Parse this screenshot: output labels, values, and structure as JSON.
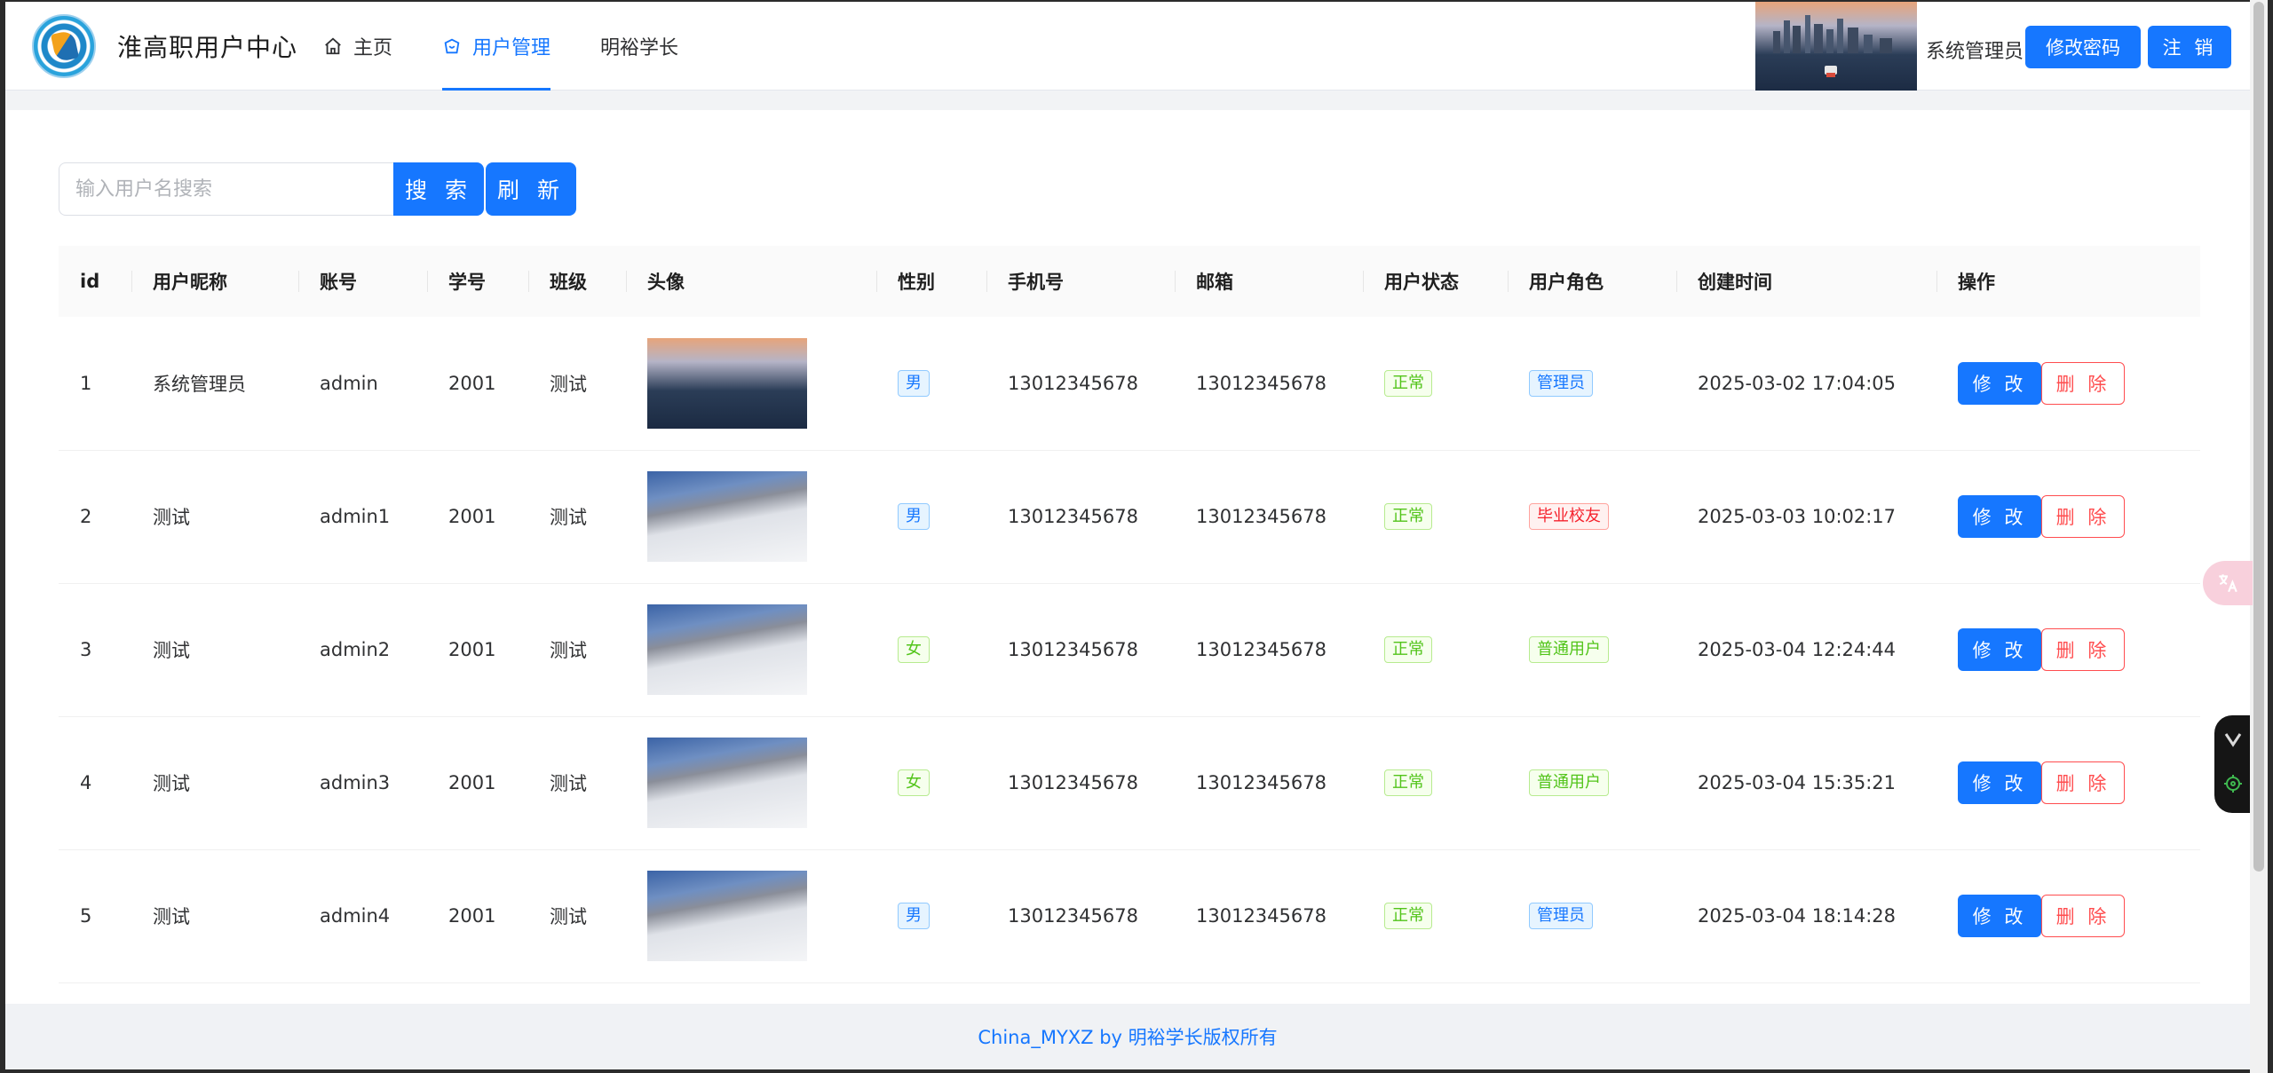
{
  "header": {
    "brand": "淮高职用户中心",
    "nav": [
      {
        "label": "主页",
        "icon": "home-icon"
      },
      {
        "label": "用户管理",
        "icon": "user-manage-icon",
        "active": true
      },
      {
        "label": "明裕学长",
        "icon": ""
      }
    ],
    "admin_name": "系统管理员",
    "change_password": "修改密码",
    "logout": "注 销"
  },
  "search": {
    "placeholder": "输入用户名搜索",
    "search_label": "搜 索",
    "refresh_label": "刷 新"
  },
  "table": {
    "columns": [
      "id",
      "用户昵称",
      "账号",
      "学号",
      "班级",
      "头像",
      "性别",
      "手机号",
      "邮箱",
      "用户状态",
      "用户角色",
      "创建时间",
      "操作"
    ],
    "edit_label": "修 改",
    "delete_label": "删 除",
    "rows": [
      {
        "id": "1",
        "nickname": "系统管理员",
        "account": "admin",
        "student_no": "2001",
        "class": "测试",
        "avatar": "city-skyline",
        "gender": "男",
        "phone": "13012345678",
        "email": "13012345678",
        "status": "正常",
        "role": "管理员",
        "created": "2025-03-02 17:04:05"
      },
      {
        "id": "2",
        "nickname": "测试",
        "account": "admin1",
        "student_no": "2001",
        "class": "测试",
        "avatar": "snow-mountain",
        "gender": "男",
        "phone": "13012345678",
        "email": "13012345678",
        "status": "正常",
        "role": "毕业校友",
        "created": "2025-03-03 10:02:17"
      },
      {
        "id": "3",
        "nickname": "测试",
        "account": "admin2",
        "student_no": "2001",
        "class": "测试",
        "avatar": "snow-mountain",
        "gender": "女",
        "phone": "13012345678",
        "email": "13012345678",
        "status": "正常",
        "role": "普通用户",
        "created": "2025-03-04 12:24:44"
      },
      {
        "id": "4",
        "nickname": "测试",
        "account": "admin3",
        "student_no": "2001",
        "class": "测试",
        "avatar": "snow-mountain",
        "gender": "女",
        "phone": "13012345678",
        "email": "13012345678",
        "status": "正常",
        "role": "普通用户",
        "created": "2025-03-04 15:35:21"
      },
      {
        "id": "5",
        "nickname": "测试",
        "account": "admin4",
        "student_no": "2001",
        "class": "测试",
        "avatar": "snow-mountain",
        "gender": "男",
        "phone": "13012345678",
        "email": "13012345678",
        "status": "正常",
        "role": "管理员",
        "created": "2025-03-04 18:14:28"
      }
    ]
  },
  "footer": {
    "text": "China_MYXZ by 明裕学长版权所有"
  },
  "colors": {
    "primary": "#1677ff",
    "danger": "#ff4d4f",
    "success": "#52c41a"
  }
}
